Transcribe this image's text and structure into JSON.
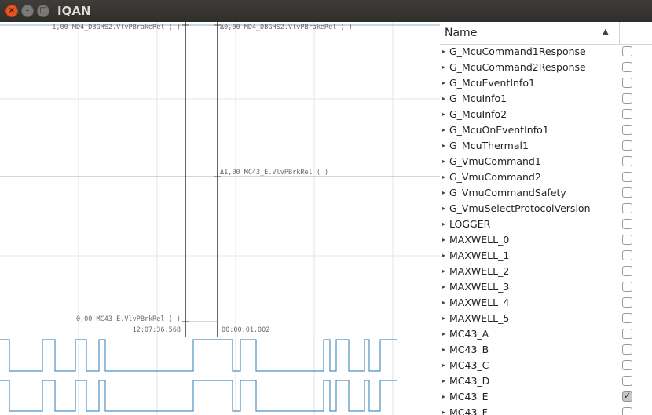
{
  "window": {
    "title": "IQAN"
  },
  "window_buttons": {
    "close": "×",
    "minimize": "–",
    "maximize": "□"
  },
  "plot": {
    "labels": {
      "top_left": "1,00 MD4_DBGHS2.VlvPBrakeRel ( )",
      "top_right": "Δ0,00 MD4_DBGHS2.VlvPBrakeRel ( )",
      "mid_right": "Δ1,00 MC43_E.VlvPBrkRel ( )",
      "bottom_left": "0,00 MC43_E.VlvPBrkRel ( )",
      "cursor_time": "12:07:36.568",
      "delta_time": "00:00:01.002"
    }
  },
  "signal_list": {
    "header": {
      "name": "Name",
      "sort_icon": "▲"
    },
    "expand_icon": "▸",
    "check_glyph": "✓",
    "items": [
      {
        "label": "G_McuCommand1Response",
        "checked": false
      },
      {
        "label": "G_McuCommand2Response",
        "checked": false
      },
      {
        "label": "G_McuEventInfo1",
        "checked": false
      },
      {
        "label": "G_McuInfo1",
        "checked": false
      },
      {
        "label": "G_McuInfo2",
        "checked": false
      },
      {
        "label": "G_McuOnEventInfo1",
        "checked": false
      },
      {
        "label": "G_McuThermal1",
        "checked": false
      },
      {
        "label": "G_VmuCommand1",
        "checked": false
      },
      {
        "label": "G_VmuCommand2",
        "checked": false
      },
      {
        "label": "G_VmuCommandSafety",
        "checked": false
      },
      {
        "label": "G_VmuSelectProtocolVersion",
        "checked": false
      },
      {
        "label": "LOGGER",
        "checked": false
      },
      {
        "label": "MAXWELL_0",
        "checked": false
      },
      {
        "label": "MAXWELL_1",
        "checked": false
      },
      {
        "label": "MAXWELL_2",
        "checked": false
      },
      {
        "label": "MAXWELL_3",
        "checked": false
      },
      {
        "label": "MAXWELL_4",
        "checked": false
      },
      {
        "label": "MAXWELL_5",
        "checked": false
      },
      {
        "label": "MC43_A",
        "checked": false
      },
      {
        "label": "MC43_B",
        "checked": false
      },
      {
        "label": "MC43_C",
        "checked": false
      },
      {
        "label": "MC43_D",
        "checked": false
      },
      {
        "label": "MC43_E",
        "checked": true
      },
      {
        "label": "MC43_F",
        "checked": false
      }
    ]
  }
}
